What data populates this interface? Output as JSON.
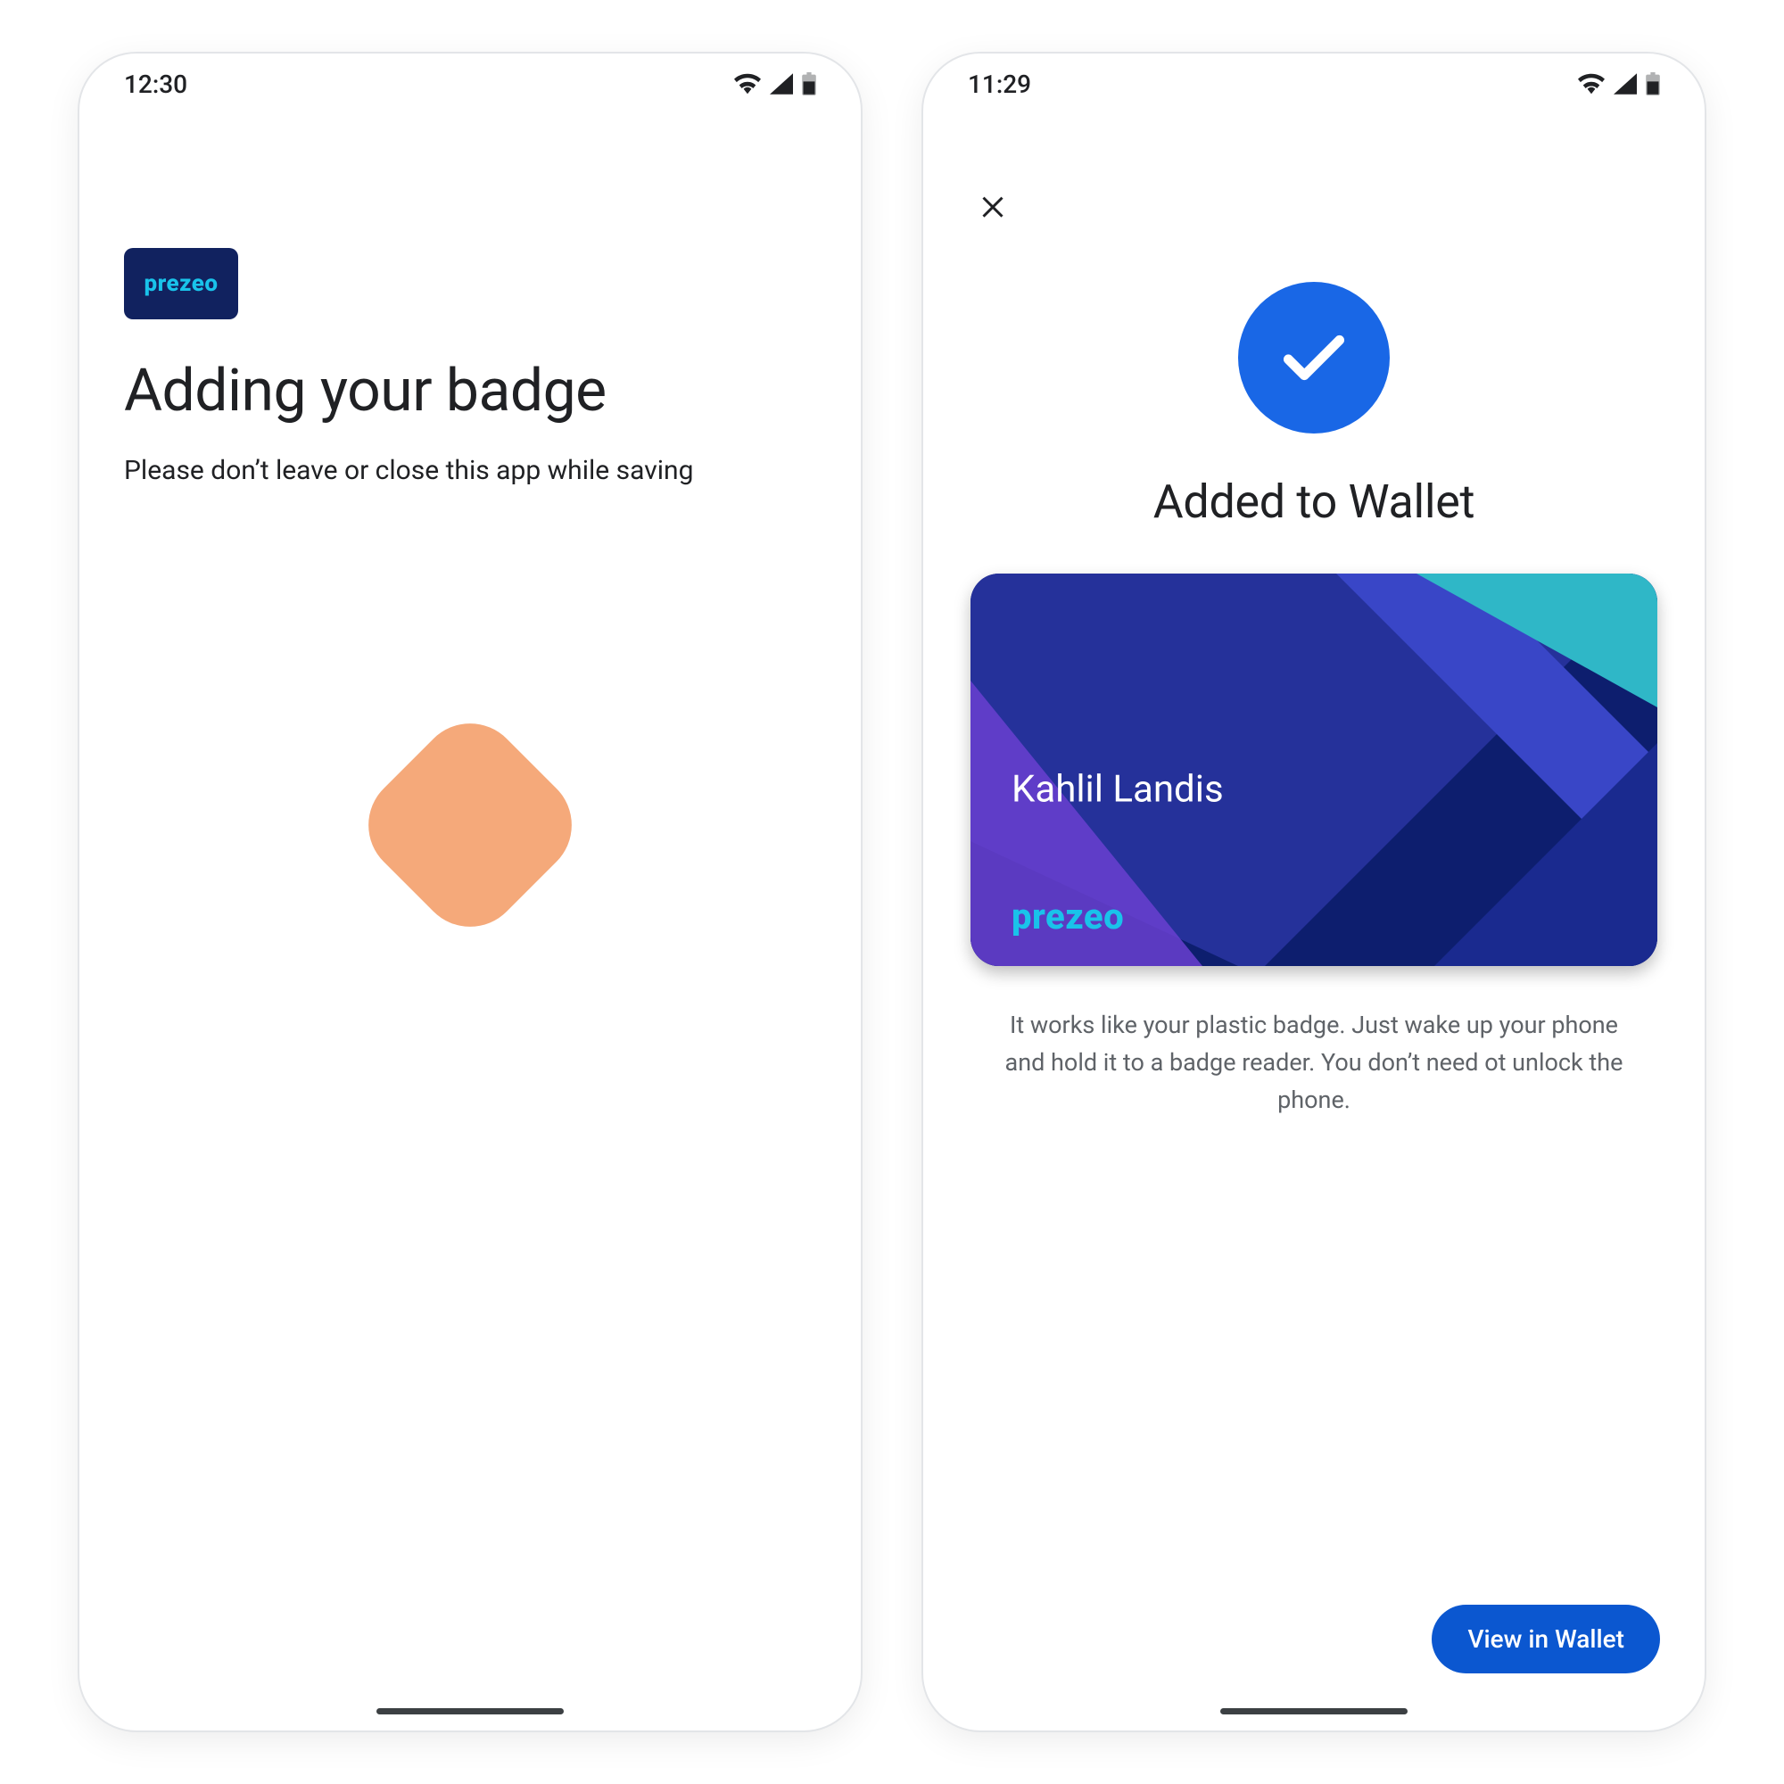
{
  "colors": {
    "primary": "#1a73e8",
    "primary_dark": "#0b57d0",
    "brand_cyan": "#19c3ea",
    "card_deep": "#11225f",
    "peach": "#f5a97a"
  },
  "phone1": {
    "status": {
      "time": "12:30"
    },
    "brand": "prezeo",
    "title": "Adding your badge",
    "subtitle": "Please don’t leave or close this app while saving"
  },
  "phone2": {
    "status": {
      "time": "11:29"
    },
    "close_label": "Close",
    "title": "Added to Wallet",
    "card": {
      "holder": "Kahlil Landis",
      "brand": "prezeo"
    },
    "description": "It works like your plastic badge. Just wake up your phone and hold it to a badge reader. You don’t need ot unlock the phone.",
    "button": "View in Wallet"
  }
}
